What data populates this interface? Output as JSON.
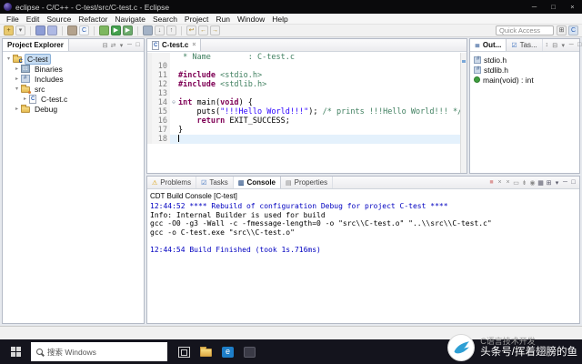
{
  "window": {
    "title": "eclipse - C/C++ - C-test/src/C-test.c - Eclipse",
    "controls": [
      {
        "name": "minimize",
        "glyph": "─"
      },
      {
        "name": "maximize",
        "glyph": "□"
      },
      {
        "name": "close",
        "glyph": "×"
      }
    ]
  },
  "menubar": {
    "items": [
      "File",
      "Edit",
      "Source",
      "Refactor",
      "Navigate",
      "Search",
      "Project",
      "Run",
      "Window",
      "Help"
    ]
  },
  "toolbar": {
    "quick_access": "Quick Access",
    "icons": [
      {
        "name": "new-wizard-icon",
        "bg": "#e9c96d",
        "fg": "#6b4f0e",
        "glyph": "+"
      },
      {
        "name": "new-dropdown-icon",
        "bg": "#f1f1f1",
        "fg": "#666666",
        "glyph": "▾"
      },
      {
        "sep": true
      },
      {
        "name": "save-icon",
        "bg": "#8d9dd6",
        "fg": "#ffffff",
        "glyph": ""
      },
      {
        "name": "save-all-icon",
        "bg": "#aeb9e4",
        "fg": "#ffffff",
        "glyph": ""
      },
      {
        "sep": true
      },
      {
        "name": "build-icon",
        "bg": "#b3a28d",
        "fg": "#564736",
        "glyph": ""
      },
      {
        "name": "new-c-source-icon",
        "bg": "#f4f7fb",
        "fg": "#2a5db0",
        "glyph": "C"
      },
      {
        "sep": true
      },
      {
        "name": "debug-icon",
        "bg": "#7db75f",
        "fg": "#2c5c1c",
        "glyph": ""
      },
      {
        "name": "run-icon",
        "bg": "#43a04d",
        "fg": "#ffffff",
        "glyph": "▶"
      },
      {
        "name": "external-tools-icon",
        "bg": "#6cab6c",
        "fg": "#ffffff",
        "glyph": "▶"
      },
      {
        "sep": true
      },
      {
        "name": "search-icon",
        "bg": "#a3b2c6",
        "fg": "#ffffff",
        "glyph": ""
      },
      {
        "name": "next-annotation-icon",
        "bg": "#efefef",
        "fg": "#666666",
        "glyph": "↓"
      },
      {
        "name": "prev-annotation-icon",
        "bg": "#efefef",
        "fg": "#666666",
        "glyph": "↑"
      },
      {
        "sep": true
      },
      {
        "name": "last-edit-location-icon",
        "bg": "#efefef",
        "fg": "#b08a2a",
        "glyph": "↩"
      },
      {
        "name": "back-icon",
        "bg": "#efefef",
        "fg": "#b08a2a",
        "glyph": "←"
      },
      {
        "name": "forward-icon",
        "bg": "#efefef",
        "fg": "#b08a2a",
        "glyph": "→"
      }
    ],
    "right_icons": [
      {
        "name": "open-perspective-icon",
        "bg": "#ececec",
        "fg": "#555555",
        "glyph": "⊞"
      },
      {
        "name": "cpp-perspective-icon",
        "bg": "#d7e3f2",
        "fg": "#2a5db0",
        "glyph": "C"
      }
    ]
  },
  "project_explorer": {
    "title": "Project Explorer",
    "header_icons": [
      {
        "name": "collapse-all-icon",
        "color": "#777777",
        "glyph": "⊟"
      },
      {
        "name": "link-with-editor-icon",
        "color": "#777777",
        "glyph": "⇄"
      },
      {
        "name": "view-menu-icon",
        "color": "#777777",
        "glyph": "▾"
      },
      {
        "name": "minimize-icon",
        "color": "#777777",
        "glyph": "─"
      },
      {
        "name": "maximize-icon",
        "color": "#777777",
        "glyph": "□"
      }
    ],
    "items": [
      {
        "label": "C-test",
        "depth": 0,
        "expander": "expanded",
        "icon": "c-project",
        "selected": true
      },
      {
        "label": "Binaries",
        "depth": 1,
        "expander": "collapsed",
        "icon": "binaries"
      },
      {
        "label": "Includes",
        "depth": 1,
        "expander": "collapsed",
        "icon": "includes"
      },
      {
        "label": "src",
        "depth": 1,
        "expander": "expanded",
        "icon": "source-folder"
      },
      {
        "label": "C-test.c",
        "depth": 2,
        "expander": "collapsed",
        "icon": "c-file"
      },
      {
        "label": "Debug",
        "depth": 1,
        "expander": "collapsed",
        "icon": "folder"
      }
    ]
  },
  "editor": {
    "tab": {
      "label": "C-test.c"
    },
    "lines": [
      {
        "num": "",
        "fold": "",
        "segments": [
          {
            "t": " * Name        : C-test.c",
            "s": "comment"
          }
        ]
      },
      {
        "num": "10",
        "segments": []
      },
      {
        "num": "11",
        "segments": [
          {
            "t": "#include",
            "s": "directive"
          },
          {
            "t": " ",
            "s": "plain"
          },
          {
            "t": "<stdio.h>",
            "s": "header"
          }
        ]
      },
      {
        "num": "12",
        "segments": [
          {
            "t": "#include",
            "s": "directive"
          },
          {
            "t": " ",
            "s": "plain"
          },
          {
            "t": "<stdlib.h>",
            "s": "header"
          }
        ]
      },
      {
        "num": "13",
        "segments": []
      },
      {
        "num": "14",
        "fold": "⊖",
        "segments": [
          {
            "t": "int",
            "s": "keyword"
          },
          {
            "t": " main(",
            "s": "plain"
          },
          {
            "t": "void",
            "s": "keyword"
          },
          {
            "t": ") {",
            "s": "plain"
          }
        ]
      },
      {
        "num": "15",
        "segments": [
          {
            "t": "    puts(",
            "s": "plain"
          },
          {
            "t": "\"!!!Hello World!!!\"",
            "s": "string"
          },
          {
            "t": "); ",
            "s": "plain"
          },
          {
            "t": "/* prints !!!Hello World!!! */",
            "s": "comment"
          }
        ]
      },
      {
        "num": "16",
        "segments": [
          {
            "t": "    ",
            "s": "plain"
          },
          {
            "t": "return",
            "s": "keyword"
          },
          {
            "t": " EXIT_SUCCESS;",
            "s": "plain"
          }
        ]
      },
      {
        "num": "17",
        "segments": [
          {
            "t": "}",
            "s": "plain"
          }
        ]
      },
      {
        "num": "18",
        "current": true,
        "segments": []
      }
    ]
  },
  "outline": {
    "tabs": [
      {
        "label": "Out...",
        "selected": true,
        "icon": "outline-icon",
        "glyph": "≣",
        "color": "#5577aa"
      },
      {
        "label": "Tas...",
        "selected": false,
        "icon": "task-list-icon",
        "glyph": "☑",
        "color": "#3a6fbd"
      }
    ],
    "header_icons": [
      {
        "name": "sort-icon",
        "color": "#777777",
        "glyph": "↕"
      },
      {
        "name": "collapse-all-icon",
        "color": "#777777",
        "glyph": "⊟"
      },
      {
        "name": "view-menu-icon",
        "color": "#777777",
        "glyph": "▾"
      },
      {
        "name": "minimize-icon",
        "color": "#777777",
        "glyph": "─"
      },
      {
        "name": "maximize-icon",
        "color": "#777777",
        "glyph": "□"
      }
    ],
    "items": [
      {
        "label": "stdio.h",
        "icon": "include"
      },
      {
        "label": "stdlib.h",
        "icon": "include"
      },
      {
        "label": "main(void) : int",
        "icon": "function"
      }
    ]
  },
  "console": {
    "tabs": [
      {
        "label": "Problems",
        "icon": "problems-icon",
        "glyph": "⚠",
        "color": "#d89b00"
      },
      {
        "label": "Tasks",
        "icon": "tasks-icon",
        "glyph": "☑",
        "color": "#3a6fbd"
      },
      {
        "label": "Console",
        "selected": true,
        "icon": "console-icon",
        "glyph": "▥",
        "color": "#33578a"
      },
      {
        "label": "Properties",
        "icon": "properties-icon",
        "glyph": "▤",
        "color": "#7a7a7a"
      }
    ],
    "toolbar_icons": [
      {
        "name": "terminate-icon",
        "color": "#dc9a9a",
        "glyph": "■"
      },
      {
        "name": "remove-launch-icon",
        "color": "#8a8a8a",
        "glyph": "×"
      },
      {
        "name": "remove-all-launches-icon",
        "color": "#8a8a8a",
        "glyph": "×"
      },
      {
        "name": "clear-console-icon",
        "color": "#8a8a8a",
        "glyph": "▭"
      },
      {
        "name": "scroll-lock-icon",
        "color": "#8a8a8a",
        "glyph": "⇟"
      },
      {
        "name": "pin-console-icon",
        "color": "#8a8a8a",
        "glyph": "◉"
      },
      {
        "name": "display-console-icon",
        "color": "#555566",
        "glyph": "▦"
      },
      {
        "name": "open-console-icon",
        "color": "#555566",
        "glyph": "⊞"
      },
      {
        "name": "view-menu-icon",
        "color": "#555566",
        "glyph": "▾"
      },
      {
        "name": "minimize-icon",
        "color": "#555566",
        "glyph": "─"
      },
      {
        "name": "maximize-icon",
        "color": "#555566",
        "glyph": "□"
      }
    ],
    "name_label": "CDT Build Console [C-test]",
    "lines": [
      {
        "text": "12:44:52 **** Rebuild of configuration Debug for project C-test ****",
        "style": "info"
      },
      {
        "text": "Info: Internal Builder is used for build",
        "style": "plain"
      },
      {
        "text": "gcc -O0 -g3 -Wall -c -fmessage-length=0 -o \"src\\\\C-test.o\" \"..\\\\src\\\\C-test.c\"",
        "style": "plain"
      },
      {
        "text": "gcc -o C-test.exe \"src\\\\C-test.o\"",
        "style": "plain"
      },
      {
        "text": "",
        "style": "plain"
      },
      {
        "text": "12:44:54 Build Finished (took 1s.716ms)",
        "style": "info"
      }
    ]
  },
  "taskbar": {
    "search_placeholder": "搜索 Windows",
    "apps": [
      {
        "name": "task-view-icon"
      },
      {
        "name": "file-explorer-icon"
      },
      {
        "name": "app-icon-1"
      },
      {
        "name": "app-icon-2"
      }
    ]
  },
  "watermark": {
    "line1": "C语言技术开发",
    "line2": "头条号/挥着翅膀的鱼"
  }
}
